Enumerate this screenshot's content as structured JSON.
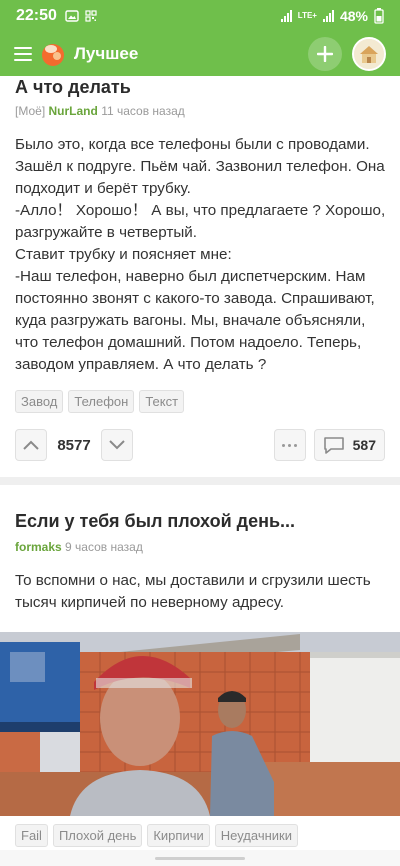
{
  "status": {
    "time": "22:50",
    "battery": "48%",
    "network": "LTE+"
  },
  "app": {
    "title": "Лучшее"
  },
  "post1": {
    "title": "А что делать",
    "community": "[Моё]",
    "author": "NurLand",
    "time": "11 часов назад",
    "lines": [
      "Было это, когда все телефоны были с проводами.",
      "Зашёл к подруге. Пьём чай. Зазвонил телефон. Она",
      "подходит и берёт трубку.",
      "-Алло！ Хорошо！ А вы, что предлагаете ? Хорошо,",
      "разгружайте в четвертый.",
      "Ставит трубку и поясняет мне:",
      "-Наш телефон, наверно был диспетчерским. Нам",
      "постоянно звонят с какого-то завода. Спрашивают,",
      "куда разгружать вагоны. Мы, вначале объясняли,",
      "что телефон домашний. Потом надоело. Теперь,",
      "заводом управляем. А что делать ?"
    ],
    "tags": [
      "Завод",
      "Телефон",
      "Текст"
    ],
    "rating": "8577",
    "comments": "587"
  },
  "post2": {
    "title": "Если у тебя был плохой день...",
    "author": "formaks",
    "time": "9 часов назад",
    "lines": [
      "То вспомни о нас, мы доставили и сгрузили шесть",
      "тысяч кирпичей по неверному адресу."
    ],
    "tags": [
      "Fail",
      "Плохой день",
      "Кирпичи",
      "Неудачники"
    ]
  },
  "colors": {
    "brand": "#6fbf4b",
    "author": "#6aa53c"
  }
}
